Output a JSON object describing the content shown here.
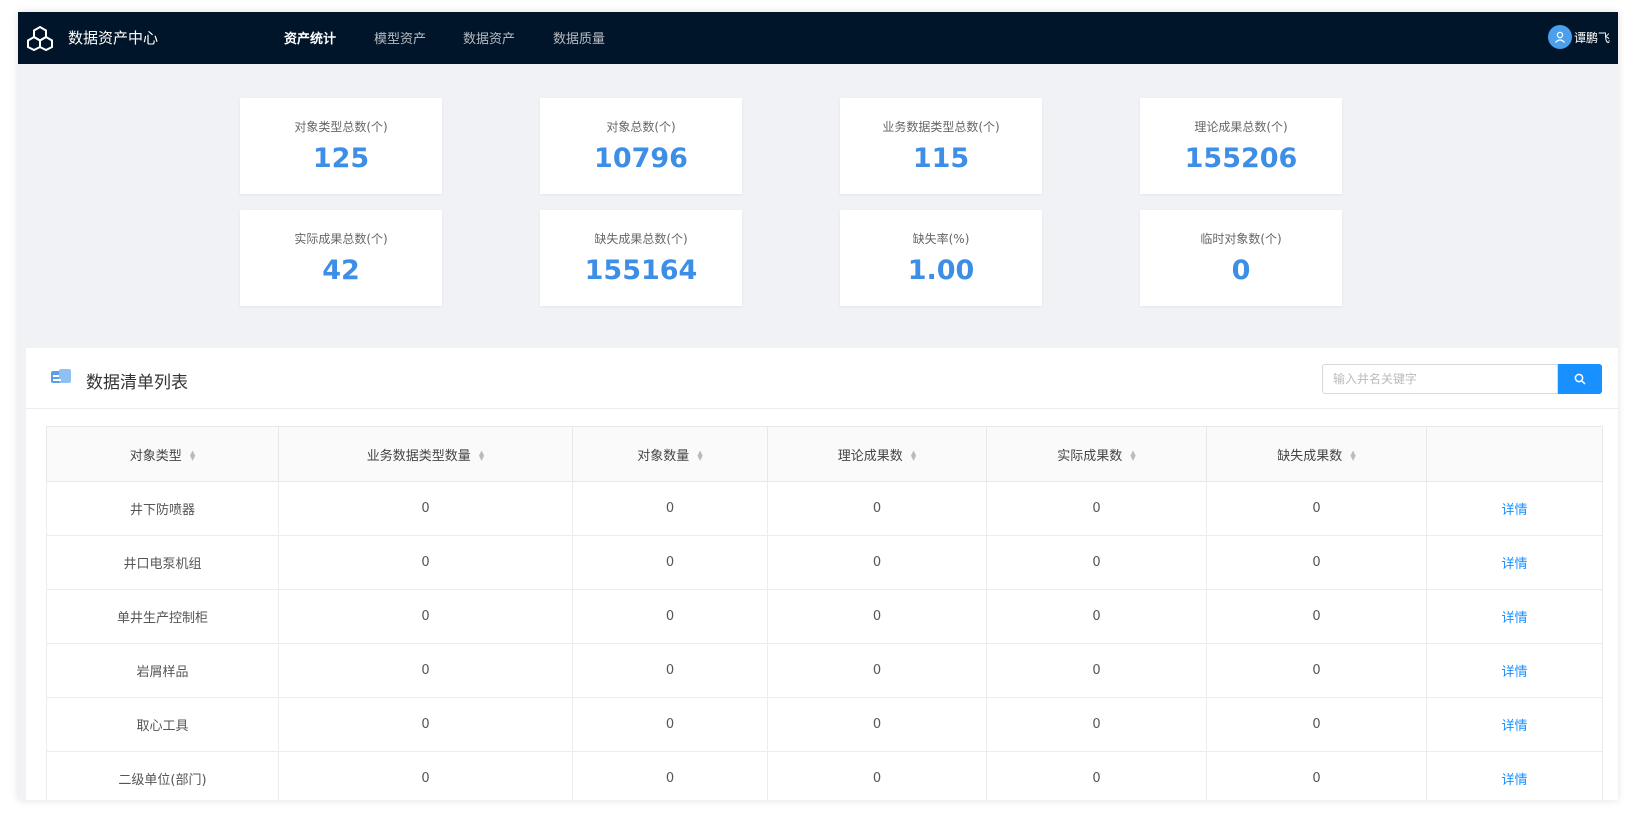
{
  "app": {
    "title": "数据资产中心",
    "nav": [
      "资产统计",
      "模型资产",
      "数据资产",
      "数据质量"
    ],
    "active_nav": "资产统计",
    "user_name": "谭鹏飞"
  },
  "stats": [
    {
      "label": "对象类型总数(个)",
      "value": "125"
    },
    {
      "label": "对象总数(个)",
      "value": "10796"
    },
    {
      "label": "业务数据类型总数(个)",
      "value": "115"
    },
    {
      "label": "理论成果总数(个)",
      "value": "155206"
    },
    {
      "label": "实际成果总数(个)",
      "value": "42"
    },
    {
      "label": "缺失成果总数(个)",
      "value": "155164"
    },
    {
      "label": "缺失率(%)",
      "value": "1.00"
    },
    {
      "label": "临时对象数(个)",
      "value": "0"
    }
  ],
  "list": {
    "title": "数据清单列表",
    "search_placeholder": "输入井名关键字",
    "columns": [
      "对象类型",
      "业务数据类型数量",
      "对象数量",
      "理论成果数",
      "实际成果数",
      "缺失成果数",
      ""
    ],
    "detail_label": "详情",
    "rows": [
      {
        "type": "井下防喷器",
        "biz_count": "0",
        "obj_count": "0",
        "theory": "0",
        "actual": "0",
        "missing": "0"
      },
      {
        "type": "井口电泵机组",
        "biz_count": "0",
        "obj_count": "0",
        "theory": "0",
        "actual": "0",
        "missing": "0"
      },
      {
        "type": "单井生产控制柜",
        "biz_count": "0",
        "obj_count": "0",
        "theory": "0",
        "actual": "0",
        "missing": "0"
      },
      {
        "type": "岩屑样品",
        "biz_count": "0",
        "obj_count": "0",
        "theory": "0",
        "actual": "0",
        "missing": "0"
      },
      {
        "type": "取心工具",
        "biz_count": "0",
        "obj_count": "0",
        "theory": "0",
        "actual": "0",
        "missing": "0"
      },
      {
        "type": "二级单位(部门)",
        "biz_count": "0",
        "obj_count": "0",
        "theory": "0",
        "actual": "0",
        "missing": "0"
      }
    ]
  },
  "colors": {
    "nav_bg": "#001529",
    "accent": "#1890ff",
    "stat_value": "#3d8ee6"
  }
}
